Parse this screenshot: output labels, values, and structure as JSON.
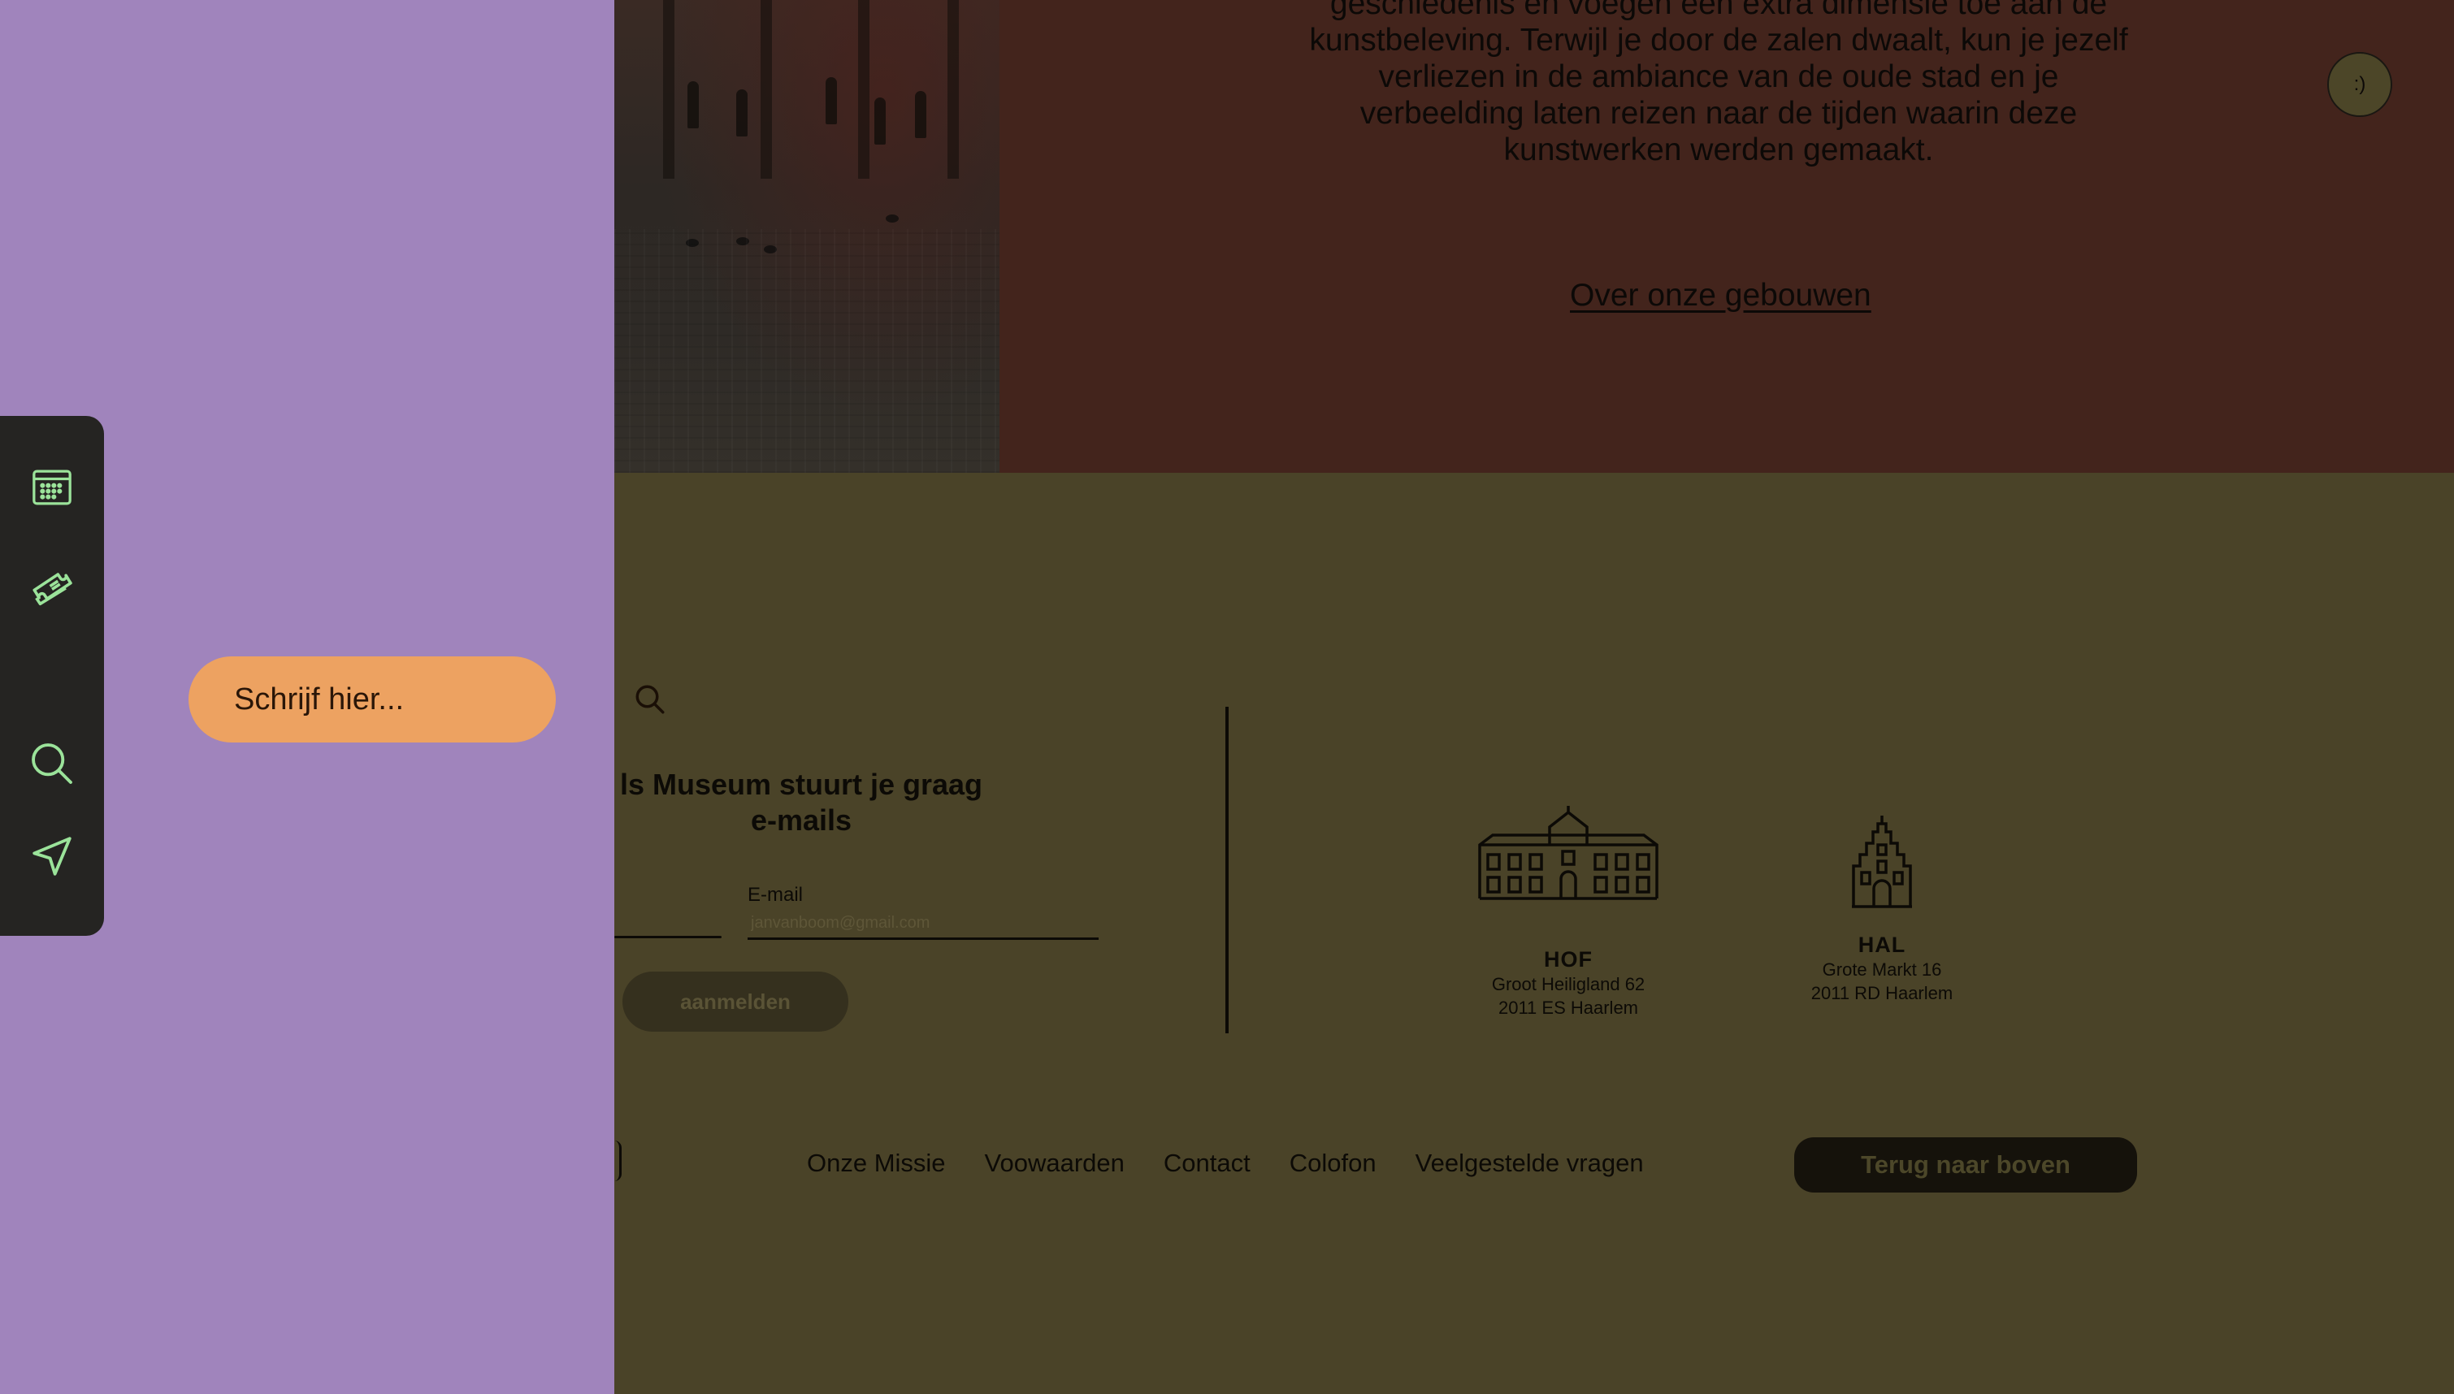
{
  "colors": {
    "overlay_panel": "#a084bc",
    "search_pill": "#eda261",
    "dock_background": "#252422",
    "dock_icon": "#9be39a",
    "top_band": "#43241c",
    "footer_band": "#4a4328"
  },
  "intro": {
    "lines": [
      "geschiedenis en voegen een extra dimensie toe aan de",
      "kunstbeleving. Terwijl je door de zalen dwaalt, kun je jezelf",
      "verliezen in de ambiance van de oude stad en je",
      "verbeelding laten reizen naar de tijden waarin deze",
      "kunstwerken werden gemaakt."
    ],
    "link": "Over onze gebouwen"
  },
  "smiley": ":)",
  "newsletter": {
    "title_line1": "ls Museum stuurt je graag",
    "title_line2": "e-mails",
    "email_label": "E-mail",
    "email_placeholder": "janvanboom@gmail.com",
    "submit_label": "aanmelden"
  },
  "locations": [
    {
      "icon": "hof-building-icon",
      "name": "HOF",
      "street": "Groot Heiligland 62",
      "city": "2011 ES Haarlem"
    },
    {
      "icon": "hal-building-icon",
      "name": "HAL",
      "street": "Grote Markt 16",
      "city": "2011 RD Haarlem"
    }
  ],
  "footer": {
    "links": [
      "Onze Missie",
      "Voowaarden",
      "Contact",
      "Colofon",
      "Veelgestelde vragen"
    ],
    "back_to_top": "Terug naar boven"
  },
  "search": {
    "placeholder": "Schrijf hier...",
    "icon": "search-icon"
  },
  "dock": {
    "items": [
      {
        "icon": "calendar-icon"
      },
      {
        "icon": "ticket-icon"
      },
      {
        "icon": "search-icon"
      },
      {
        "icon": "navigation-arrow-icon"
      }
    ]
  }
}
